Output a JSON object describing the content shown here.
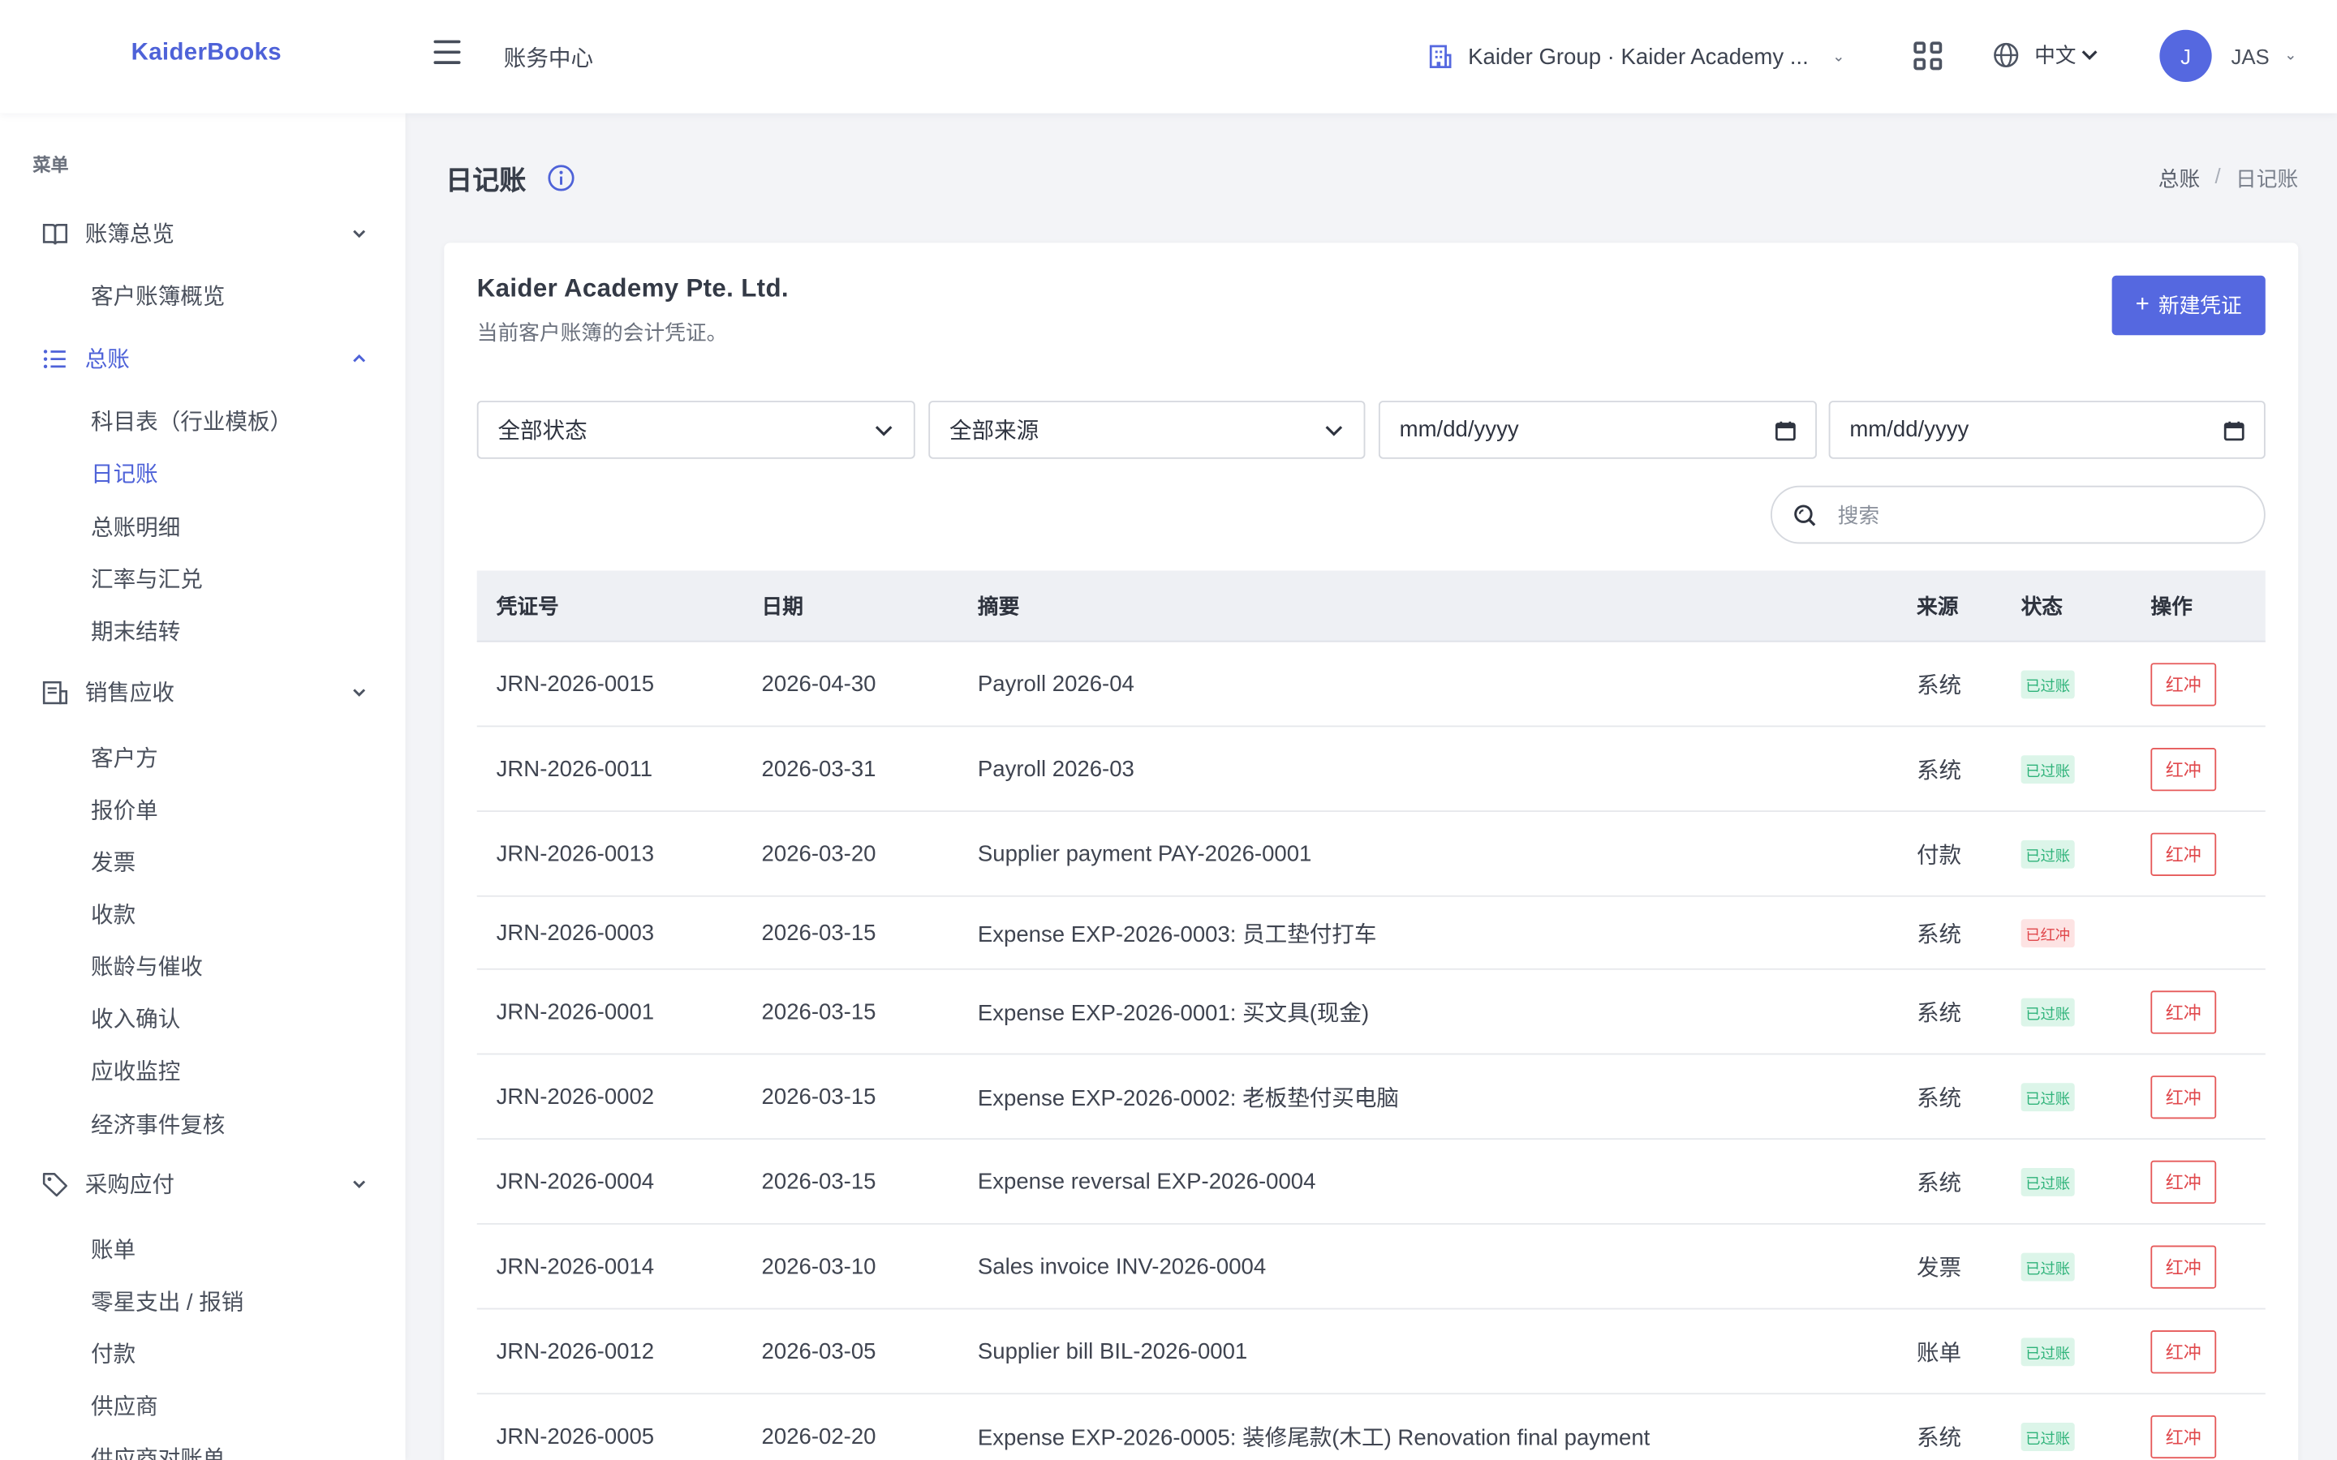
{
  "brand": "KaiderBooks",
  "topbar": {
    "section": "账务中心",
    "org": "Kaider Group · Kaider Academy ...",
    "lang": "中文",
    "avatar_initial": "J",
    "user": "JAS"
  },
  "sidebar": {
    "menu_title": "菜单",
    "sections": [
      {
        "label": "账簿总览",
        "items": [
          "客户账簿概览"
        ]
      },
      {
        "label": "总账",
        "items": [
          "科目表（行业模板）",
          "日记账",
          "总账明细",
          "汇率与汇兑",
          "期末结转"
        ]
      },
      {
        "label": "销售应收",
        "items": [
          "客户方",
          "报价单",
          "发票",
          "收款",
          "账龄与催收",
          "收入确认",
          "应收监控",
          "经济事件复核"
        ]
      },
      {
        "label": "采购应付",
        "items": [
          "账单",
          "零星支出 / 报销",
          "付款",
          "供应商",
          "供应商对账单"
        ]
      }
    ]
  },
  "page": {
    "title": "日记账",
    "breadcrumb": [
      "总账",
      "日记账"
    ]
  },
  "card": {
    "company": "Kaider Academy Pte. Ltd.",
    "subtitle": "当前客户账簿的会计凭证。",
    "new_button": "新建凭证",
    "filters": {
      "status": "全部状态",
      "source": "全部来源",
      "date_from": "mm/dd/yyyy",
      "date_to": "mm/dd/yyyy"
    },
    "search_placeholder": "搜索"
  },
  "table": {
    "headers": [
      "凭证号",
      "日期",
      "摘要",
      "来源",
      "状态",
      "操作"
    ],
    "rows": [
      {
        "no": "JRN-2026-0015",
        "date": "2026-04-30",
        "memo": "Payroll 2026-04",
        "source": "系统",
        "status": "已过账",
        "action": "红冲"
      },
      {
        "no": "JRN-2026-0011",
        "date": "2026-03-31",
        "memo": "Payroll 2026-03",
        "source": "系统",
        "status": "已过账",
        "action": "红冲"
      },
      {
        "no": "JRN-2026-0013",
        "date": "2026-03-20",
        "memo": "Supplier payment PAY-2026-0001",
        "source": "付款",
        "status": "已过账",
        "action": "红冲"
      },
      {
        "no": "JRN-2026-0003",
        "date": "2026-03-15",
        "memo": "Expense EXP-2026-0003: 员工垫付打车",
        "source": "系统",
        "status": "已红冲",
        "action": ""
      },
      {
        "no": "JRN-2026-0001",
        "date": "2026-03-15",
        "memo": "Expense EXP-2026-0001: 买文具(现金)",
        "source": "系统",
        "status": "已过账",
        "action": "红冲"
      },
      {
        "no": "JRN-2026-0002",
        "date": "2026-03-15",
        "memo": "Expense EXP-2026-0002: 老板垫付买电脑",
        "source": "系统",
        "status": "已过账",
        "action": "红冲"
      },
      {
        "no": "JRN-2026-0004",
        "date": "2026-03-15",
        "memo": "Expense reversal EXP-2026-0004",
        "source": "系统",
        "status": "已过账",
        "action": "红冲"
      },
      {
        "no": "JRN-2026-0014",
        "date": "2026-03-10",
        "memo": "Sales invoice INV-2026-0004",
        "source": "发票",
        "status": "已过账",
        "action": "红冲"
      },
      {
        "no": "JRN-2026-0012",
        "date": "2026-03-05",
        "memo": "Supplier bill BIL-2026-0001",
        "source": "账单",
        "status": "已过账",
        "action": "红冲"
      },
      {
        "no": "JRN-2026-0005",
        "date": "2026-02-20",
        "memo": "Expense EXP-2026-0005: 装修尾款(木工) Renovation final payment",
        "source": "系统",
        "status": "已过账",
        "action": "红冲"
      }
    ]
  },
  "colors": {
    "accent": "#5568e0",
    "posted_bg": "#dcf5e9",
    "posted_fg": "#2fb37a",
    "reversed_bg": "#fde3e3",
    "reversed_fg": "#e0484c"
  }
}
